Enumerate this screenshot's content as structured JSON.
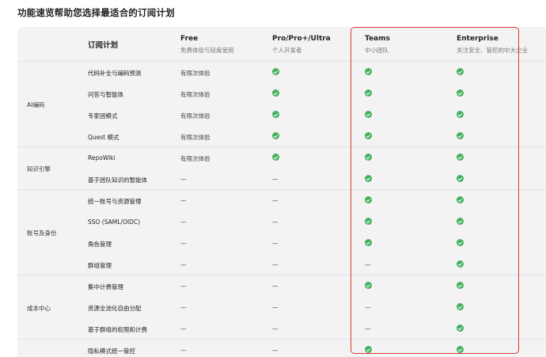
{
  "page_title": "功能速览帮助您选择最适合的订阅计划",
  "header": {
    "plan_label": "订阅计划",
    "plans": [
      {
        "name": "Free",
        "sub": "免费体验与轻度使用"
      },
      {
        "name": "Pro/Pro+/Ultra",
        "sub": "个人开发者"
      },
      {
        "name": "Teams",
        "sub": "中小团队"
      },
      {
        "name": "Enterprise",
        "sub": "关注安全、管控的中大企业"
      }
    ]
  },
  "cell_types": {
    "check": "check-icon",
    "dash": "—",
    "limited": "有限次体验"
  },
  "groups": [
    {
      "label": "AI编码",
      "rows": [
        {
          "feature": "代码补全与编码预测",
          "values": [
            "有限次体验",
            "check",
            "check",
            "check"
          ]
        },
        {
          "feature": "问答与智能体",
          "values": [
            "有限次体验",
            "check",
            "check",
            "check"
          ]
        },
        {
          "feature": "专家团模式",
          "values": [
            "有限次体验",
            "check",
            "check",
            "check"
          ]
        },
        {
          "feature": "Quest 模式",
          "values": [
            "有限次体验",
            "check",
            "check",
            "check"
          ]
        }
      ]
    },
    {
      "label": "知识引擎",
      "rows": [
        {
          "feature": "RepoWiki",
          "values": [
            "有限次体验",
            "check",
            "check",
            "check"
          ]
        },
        {
          "feature": "基于团队知识的智能体",
          "values": [
            "dash",
            "dash",
            "check",
            "check"
          ]
        }
      ]
    },
    {
      "label": "账号及身份",
      "rows": [
        {
          "feature": "统一账号与资源管理",
          "values": [
            "dash",
            "dash",
            "check",
            "check"
          ]
        },
        {
          "feature": "SSO (SAML/OIDC)",
          "values": [
            "dash",
            "dash",
            "check",
            "check"
          ]
        },
        {
          "feature": "角色管理",
          "values": [
            "dash",
            "dash",
            "check",
            "check"
          ]
        },
        {
          "feature": "群组管理",
          "values": [
            "dash",
            "dash",
            "dash",
            "check"
          ]
        }
      ]
    },
    {
      "label": "成本中心",
      "rows": [
        {
          "feature": "集中计费管理",
          "values": [
            "dash",
            "dash",
            "check",
            "check"
          ]
        },
        {
          "feature": "资源全池化自由分配",
          "values": [
            "dash",
            "dash",
            "dash",
            "check"
          ]
        },
        {
          "feature": "基于群组的权限和计费",
          "values": [
            "dash",
            "dash",
            "dash",
            "check"
          ]
        }
      ]
    },
    {
      "label": "",
      "rows": [
        {
          "feature": "隐私模式统一管控",
          "values": [
            "dash",
            "dash",
            "check",
            "check"
          ]
        }
      ]
    }
  ],
  "highlight_color": "#d9383a",
  "check_color": "#43b05c"
}
